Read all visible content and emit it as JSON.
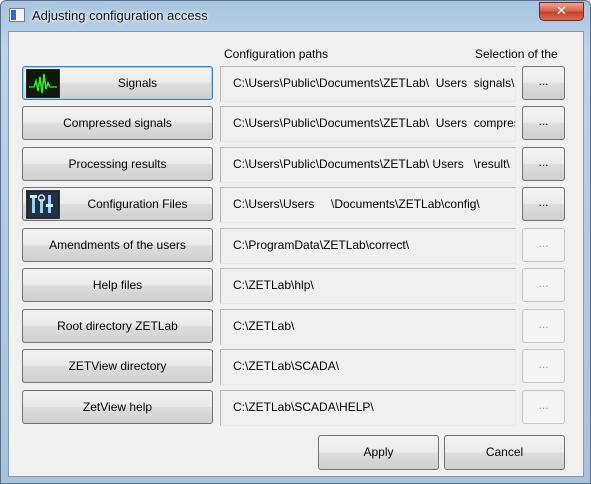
{
  "window": {
    "title": "Adjusting configuration access",
    "close_label": "✕"
  },
  "headers": {
    "paths": "Configuration paths",
    "selection": "Selection of the"
  },
  "rows": [
    {
      "label": "Signals",
      "path": "C:\\Users\\Public\\Documents\\ZETLab\\  Users  signals\\",
      "icon": "signal-waveform-icon",
      "browse": "...",
      "browse_enabled": true
    },
    {
      "label": "Compressed signals",
      "path": "C:\\Users\\Public\\Documents\\ZETLab\\  Users  compressed\\",
      "icon": null,
      "browse": "...",
      "browse_enabled": true
    },
    {
      "label": "Processing results",
      "path": "C:\\Users\\Public\\Documents\\ZETLab\\ Users   \\result\\",
      "icon": null,
      "browse": "...",
      "browse_enabled": true
    },
    {
      "label": "Configuration Files",
      "path": "C:\\Users\\Users     \\Documents\\ZETLab\\config\\",
      "icon": "configuration-tools-icon",
      "browse": "...",
      "browse_enabled": true
    },
    {
      "label": "Amendments of the users",
      "path": "C:\\ProgramData\\ZETLab\\correct\\",
      "icon": null,
      "browse": "...",
      "browse_enabled": false
    },
    {
      "label": "Help files",
      "path": "C:\\ZETLab\\hlp\\",
      "icon": null,
      "browse": "...",
      "browse_enabled": false
    },
    {
      "label": "Root directory ZETLab",
      "path": "C:\\ZETLab\\",
      "icon": null,
      "browse": "...",
      "browse_enabled": false
    },
    {
      "label": "ZETView directory",
      "path": "C:\\ZETLab\\SCADA\\",
      "icon": null,
      "browse": "...",
      "browse_enabled": false
    },
    {
      "label": "ZetView help",
      "path": "C:\\ZETLab\\SCADA\\HELP\\",
      "icon": null,
      "browse": "...",
      "browse_enabled": false
    }
  ],
  "actions": {
    "apply": "Apply",
    "cancel": "Cancel"
  },
  "colors": {
    "title_glass": "#b4cce6",
    "client_bg": "#f0f0f0",
    "close_red": "#c7412b",
    "focus_blue": "#3c7fb1"
  }
}
